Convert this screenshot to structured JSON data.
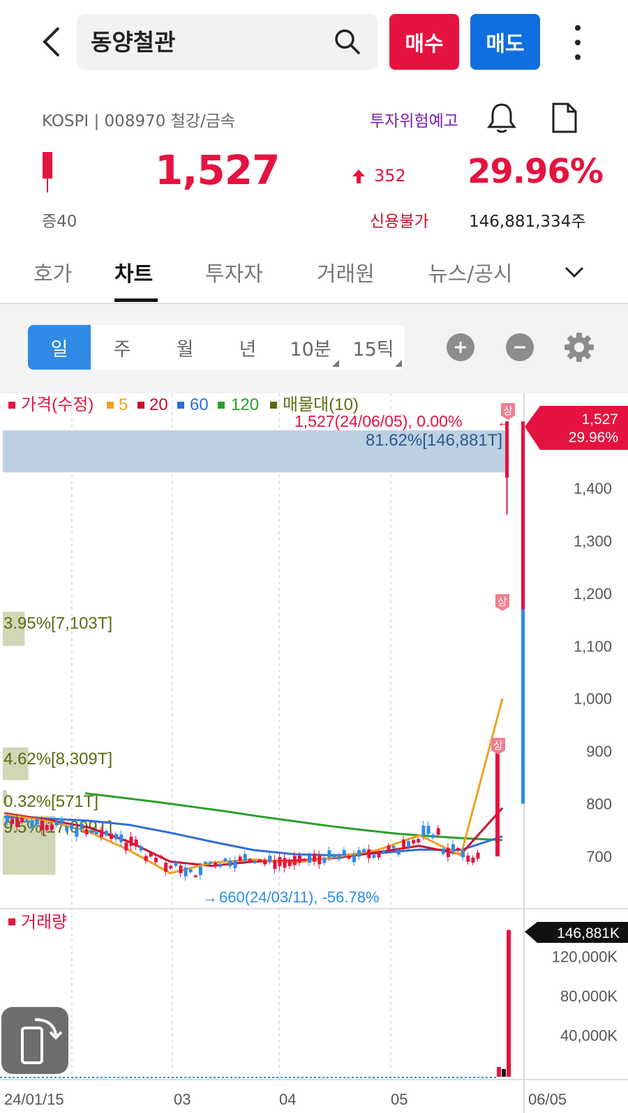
{
  "header": {
    "title": "동양철관",
    "buy_label": "매수",
    "sell_label": "매도"
  },
  "info": {
    "market": "KOSPI | 008970 철강/금속",
    "warning": "투자위험예고",
    "price": "1,527",
    "change": "352",
    "change_pct": "29.96%",
    "margin": "증40",
    "credit": "신용불가",
    "shares": "146,881,334주"
  },
  "tabs": [
    {
      "label": "호가"
    },
    {
      "label": "차트"
    },
    {
      "label": "투자자"
    },
    {
      "label": "거래원"
    },
    {
      "label": "뉴스/공시"
    }
  ],
  "periods": [
    {
      "label": "일"
    },
    {
      "label": "주"
    },
    {
      "label": "월"
    },
    {
      "label": "년"
    },
    {
      "label": "10분"
    },
    {
      "label": "15틱"
    }
  ],
  "colors": {
    "up": "#e5133f",
    "down": "#2e8be6",
    "ma5": "#f0a020",
    "ma20": "#c8102e",
    "ma60": "#2e6fd8",
    "ma120": "#2aa02a",
    "profile": "#5a6a10"
  },
  "chart_data": {
    "type": "line",
    "legend": {
      "price": "가격(수정)",
      "ma5": "5",
      "ma20": "20",
      "ma60": "60",
      "ma120": "120",
      "profile": "매물대(10)"
    },
    "current_label": "1,527",
    "current_pct_label": "29.96%",
    "high_annotation": "1,527(24/06/05), 0.00%",
    "low_annotation": "660(24/03/11), -56.78%",
    "limit_up_marker": "상",
    "y_ticks": [
      {
        "value": 1400,
        "label": "1,400"
      },
      {
        "value": 1300,
        "label": "1,300"
      },
      {
        "value": 1200,
        "label": "1,200"
      },
      {
        "value": 1100,
        "label": "1,100"
      },
      {
        "value": 1000,
        "label": "1,000"
      },
      {
        "value": 900,
        "label": "900"
      },
      {
        "value": 800,
        "label": "800"
      },
      {
        "value": 700,
        "label": "700"
      }
    ],
    "x_ticks": [
      "24/01/15",
      "03",
      "04",
      "05",
      "06/05"
    ],
    "volume_profile": [
      {
        "label": "81.62%[146,881T]",
        "price_from": 1430,
        "price_to": 1510
      },
      {
        "label": "3.95%[7,103T]",
        "price_from": 1100,
        "price_to": 1165
      },
      {
        "label": "4.62%[8,309T]",
        "price_from": 845,
        "price_to": 907
      },
      {
        "label": "0.32%[571T]",
        "price_from": 800,
        "price_to": 826
      },
      {
        "label": "9.5%[17,099T]",
        "price_from": 665,
        "price_to": 777
      }
    ],
    "ma_series": [
      {
        "name": "120",
        "values": [
          820,
          812,
          804,
          795,
          786,
          776,
          767,
          758,
          750,
          743,
          738,
          734,
          731
        ]
      },
      {
        "name": "60",
        "values": [
          775,
          772,
          768,
          760,
          745,
          728,
          712,
          704,
          702,
          706,
          713,
          712,
          738
        ]
      },
      {
        "name": "20",
        "values": [
          782,
          770,
          756,
          728,
          690,
          682,
          690,
          692,
          697,
          708,
          720,
          704,
          792
        ]
      },
      {
        "name": "5",
        "values": [
          780,
          768,
          748,
          712,
          668,
          688,
          694,
          688,
          699,
          712,
          740,
          702,
          1000
        ]
      }
    ],
    "volume_panel": {
      "title": "거래량",
      "last_label": "146,881K",
      "y_ticks": [
        {
          "value": 120000,
          "label": "120,000K"
        },
        {
          "value": 80000,
          "label": "80,000K"
        },
        {
          "value": 40000,
          "label": "40,000K"
        }
      ],
      "last_value": 146881
    }
  }
}
